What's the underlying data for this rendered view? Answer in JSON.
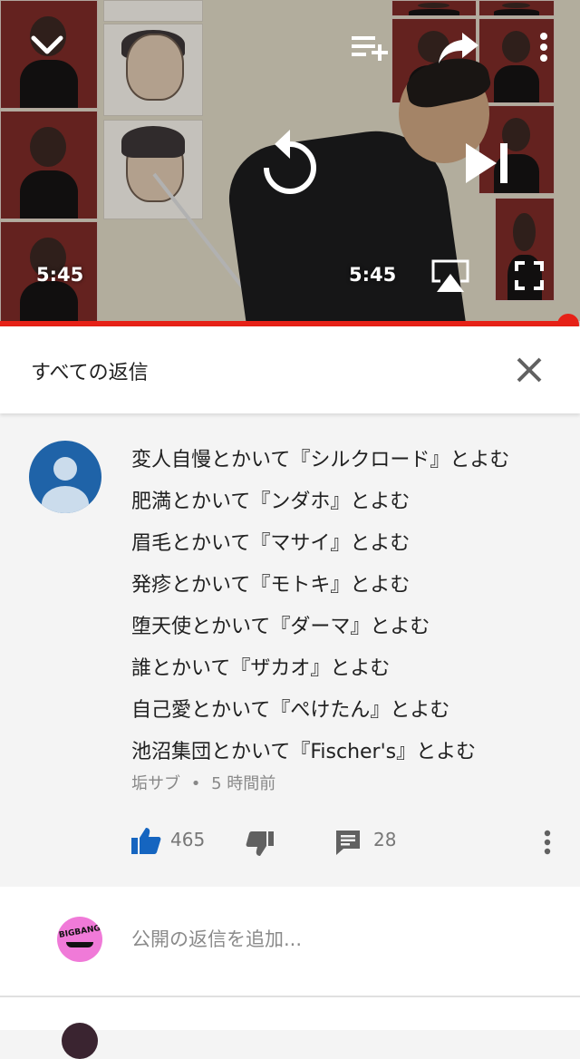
{
  "player": {
    "time_left": "5:45",
    "time_right": "5:45",
    "progress_fraction": 0.98,
    "icons": {
      "minimize": "chevron-down-icon",
      "add_to_playlist": "playlist-add-icon",
      "share": "share-icon",
      "more": "more-vert-icon",
      "replay": "replay-icon",
      "next": "skip-next-icon",
      "airplay": "airplay-icon",
      "fullscreen": "fullscreen-icon"
    },
    "accent_color": "#e62117"
  },
  "replies_header": {
    "title": "すべての返信",
    "close_icon": "close-icon"
  },
  "comment": {
    "lines": [
      "変人自慢とかいて『シルクロード』とよむ",
      "肥満とかいて『ンダホ』とよむ",
      "眉毛とかいて『マサイ』とよむ",
      "発疹とかいて『モトキ』とよむ",
      "堕天使とかいて『ダーマ』とよむ",
      "誰とかいて『ザカオ』とよむ",
      "自己愛とかいて『ぺけたん』とよむ",
      "池沼集団とかいて『Fischer's』とよむ"
    ],
    "author": "垢サブ",
    "separator": "•",
    "time_ago": "5 時間前",
    "likes": "465",
    "replies": "28",
    "like_color": "#1565c0"
  },
  "add_reply": {
    "placeholder": "公開の返信を追加...",
    "avatar_logo_text": "BIGBANG"
  }
}
